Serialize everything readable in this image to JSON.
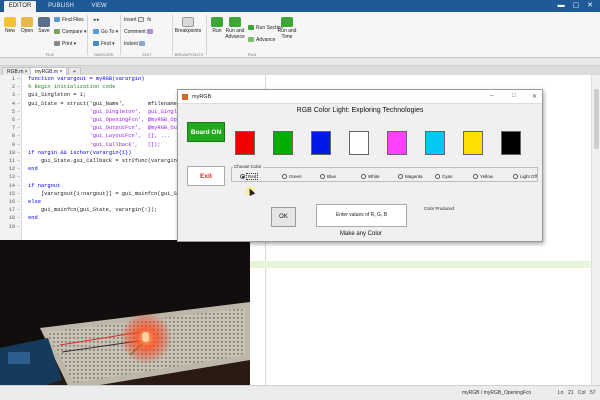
{
  "window": {
    "tabs": [
      "EDITOR",
      "PUBLISH",
      "VIEW"
    ],
    "active_tab": "EDITOR"
  },
  "ribbon": {
    "file": {
      "new": "New",
      "open": "Open",
      "save": "Save",
      "find_files": "Find Files",
      "compare": "Compare",
      "print": "Print"
    },
    "navigate": {
      "go_to": "Go To",
      "find": "Find"
    },
    "edit": {
      "insert": "Insert",
      "comment": "Comment",
      "indent": "Indent",
      "fx": "fx"
    },
    "breakpoints": {
      "label": "Breakpoints"
    },
    "run": {
      "run": "Run",
      "run_and_advance": "Run and Advance",
      "run_section": "Run Section",
      "advance": "Advance",
      "run_and_time": "Run and Time"
    },
    "sections": [
      "FILE",
      "NAVIGATE",
      "EDIT",
      "BREAKPOINTS",
      "RUN"
    ]
  },
  "file_tabs": [
    "RGB.m",
    "myRGB.m"
  ],
  "active_file": "myRGB.m",
  "editor": {
    "lines": [
      {
        "n": "1",
        "text": "function varargout = myRGB(varargin)"
      },
      {
        "n": "2",
        "text": "% Begin initialization code"
      },
      {
        "n": "3",
        "text": "gui_Singleton = 1;"
      },
      {
        "n": "4",
        "text": "gui_State = struct('gui_Name',       mfilename, ..."
      },
      {
        "n": "5",
        "text": "                   'gui_Singleton',  gui_Singleton, ..."
      },
      {
        "n": "6",
        "text": "                   'gui_OpeningFcn', @myRGB_OpeningFcn, ..."
      },
      {
        "n": "7",
        "text": "                   'gui_OutputFcn',  @myRGB_OutputFcn, ..."
      },
      {
        "n": "8",
        "text": "                   'gui_LayoutFcn',  [], ..."
      },
      {
        "n": "9",
        "text": "                   'gui_Callback',   []);"
      },
      {
        "n": "10",
        "text": "if nargin && ischar(varargin{1})"
      },
      {
        "n": "11",
        "text": "    gui_State.gui_Callback = str2func(varargin{1});"
      },
      {
        "n": "12",
        "text": "end"
      },
      {
        "n": "13",
        "text": ""
      },
      {
        "n": "14",
        "text": "if nargout"
      },
      {
        "n": "15",
        "text": "    [varargout{1:nargout}] = gui_mainfcn(gui_State, varargin{:});"
      },
      {
        "n": "16",
        "text": "else"
      },
      {
        "n": "17",
        "text": "    gui_mainfcn(gui_State, varargin{:});"
      },
      {
        "n": "18",
        "text": "end"
      },
      {
        "n": "19",
        "text": ""
      }
    ]
  },
  "status": {
    "function": "myRGB / myRGB_OpeningFcn",
    "line_label": "Ln",
    "line": "21",
    "col_label": "Col",
    "col": "57"
  },
  "gui": {
    "title": "myRGB",
    "heading": "RGB Color Light: Exploring Technologies",
    "board_on": "Board ON",
    "exit": "Exit",
    "swatches": [
      "#f20000",
      "#00b000",
      "#0018e8",
      "#ffffff",
      "#ff40ff",
      "#00c8f2",
      "#ffe000",
      "#000000"
    ],
    "choose_color_label": "Choose Color",
    "radio_options": [
      "Red",
      "Green",
      "Blue",
      "White",
      "Magenta",
      "Cyan",
      "Yellow",
      "Light Off"
    ],
    "selected_option": "Red",
    "ok": "OK",
    "rgb_prompt": "Enter values of R, G, B",
    "color_produced": "Color Produced",
    "make_any_color": "Make any Color"
  }
}
